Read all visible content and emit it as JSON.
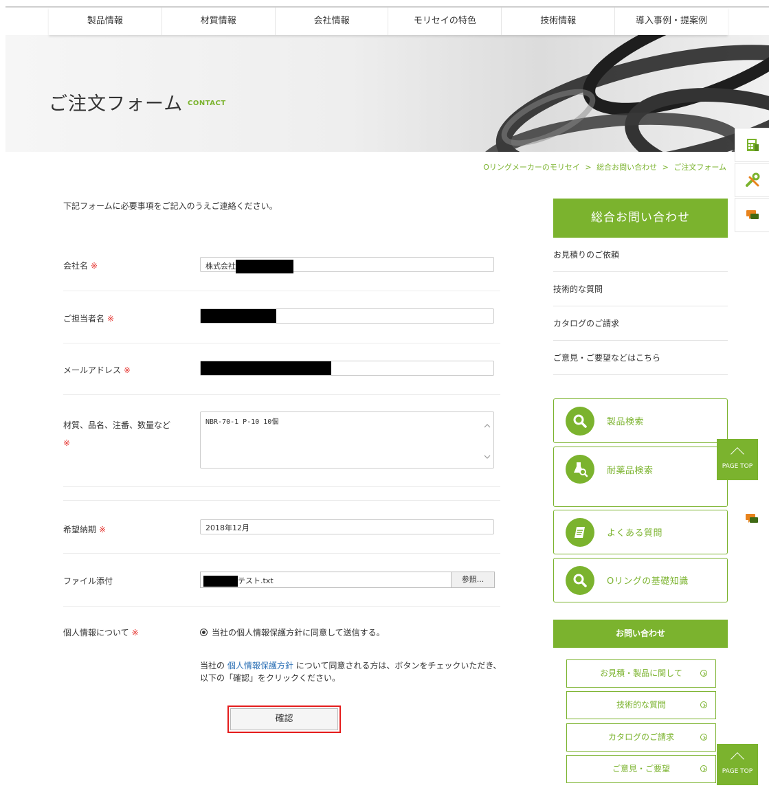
{
  "nav": {
    "items": [
      "製品情報",
      "材質情報",
      "会社情報",
      "モリセイの特色",
      "技術情報",
      "導入事例・提案例"
    ]
  },
  "hero": {
    "title": "ご注文フォーム",
    "subtitle": "CONTACT"
  },
  "breadcrumb": {
    "items": [
      "Oリングメーカーのモリセイ",
      "総合お問い合わせ",
      "ご注文フォーム"
    ],
    "separator": ">"
  },
  "form": {
    "intro": "下記フォームに必要事項をご記入のうえご連絡ください。",
    "required_mark": "※",
    "company": {
      "label": "会社名",
      "value": "株式会社"
    },
    "contact_person": {
      "label": "ご担当者名",
      "value": ""
    },
    "email": {
      "label": "メールアドレス",
      "value": ""
    },
    "details": {
      "label": "材質、品名、注番、数量など",
      "value": "NBR-70-1 P-10 10個"
    },
    "delivery": {
      "label": "希望納期",
      "value": "2018年12月"
    },
    "file": {
      "label": "ファイル添付",
      "filename": "テスト.txt",
      "browse_label": "参照..."
    },
    "privacy": {
      "label": "個人情報について",
      "radio_label": "当社の個人情報保護方針に同意して送信する。",
      "note_prefix": "当社の",
      "note_link": "個人情報保護方針",
      "note_suffix": "について同意される方は、ボタンをチェックいただき、 以下の「確認」をクリックください。"
    },
    "confirm_label": "確認"
  },
  "sidebar": {
    "heading": "総合お問い合わせ",
    "links": [
      "お見積りのご依頼",
      "技術的な質問",
      "カタログのご請求",
      "ご意見・ご要望などはこちら"
    ],
    "boxes": [
      {
        "label": "製品検索",
        "icon": "search-icon"
      },
      {
        "label": "耐薬品検索",
        "icon": "flask-search-icon"
      },
      {
        "label": "よくある質問",
        "icon": "notebook-icon"
      },
      {
        "label": "Oリングの基礎知識",
        "icon": "search-icon"
      }
    ],
    "contact_heading": "お問い合わせ",
    "contact_links": [
      "お見積・製品に関して",
      "技術的な質問",
      "カタログのご請求",
      "ご意見・ご要望"
    ]
  },
  "page_top": {
    "label": "PAGE TOP"
  },
  "colors": {
    "accent": "#7bb32e",
    "required": "#e5322d",
    "link": "#2a6fb5",
    "highlight": "#e41b1b"
  }
}
